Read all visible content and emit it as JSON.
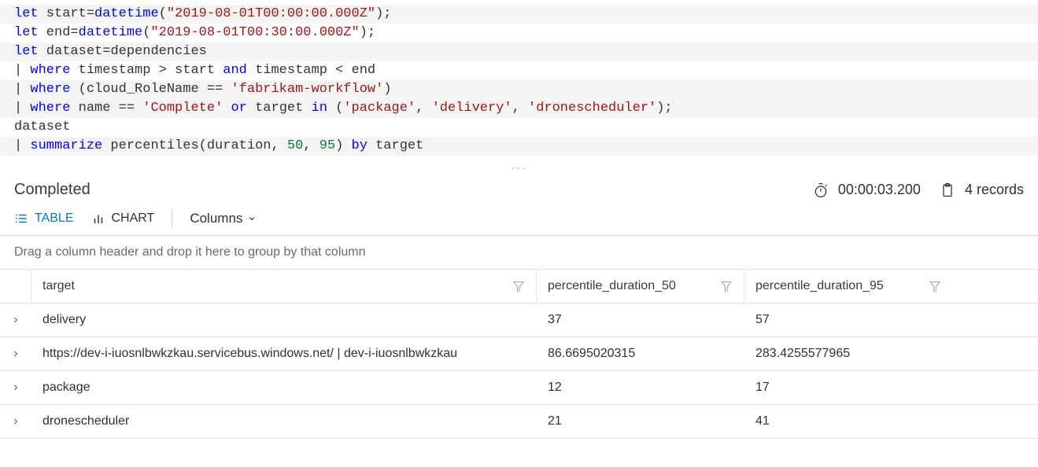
{
  "query": {
    "lines": [
      {
        "hl": true,
        "tokens": [
          [
            "kw",
            "let"
          ],
          [
            "id",
            " start"
          ],
          [
            "op",
            "="
          ],
          [
            "fn",
            "datetime"
          ],
          [
            "op",
            "("
          ],
          [
            "str",
            "\"2019-08-01T00:00:00.000Z\""
          ],
          [
            "op",
            ");"
          ]
        ]
      },
      {
        "hl": false,
        "tokens": [
          [
            "kw",
            "let"
          ],
          [
            "id",
            " end"
          ],
          [
            "op",
            "="
          ],
          [
            "fn",
            "datetime"
          ],
          [
            "op",
            "("
          ],
          [
            "str",
            "\"2019-08-01T00:30:00.000Z\""
          ],
          [
            "op",
            ");"
          ]
        ]
      },
      {
        "hl": true,
        "tokens": [
          [
            "kw",
            "let"
          ],
          [
            "id",
            " dataset"
          ],
          [
            "op",
            "="
          ],
          [
            "id",
            "dependencies"
          ]
        ]
      },
      {
        "hl": false,
        "tokens": [
          [
            "op",
            "| "
          ],
          [
            "kw",
            "where"
          ],
          [
            "id",
            " timestamp "
          ],
          [
            "op",
            ">"
          ],
          [
            "id",
            " start "
          ],
          [
            "kw",
            "and"
          ],
          [
            "id",
            " timestamp "
          ],
          [
            "op",
            "<"
          ],
          [
            "id",
            " end"
          ]
        ]
      },
      {
        "hl": true,
        "tokens": [
          [
            "op",
            "| "
          ],
          [
            "kw",
            "where"
          ],
          [
            "id",
            " (cloud_RoleName "
          ],
          [
            "op",
            "=="
          ],
          [
            "id",
            " "
          ],
          [
            "str",
            "'fabrikam-workflow'"
          ],
          [
            "op",
            ")"
          ]
        ]
      },
      {
        "hl": true,
        "tokens": [
          [
            "op",
            "| "
          ],
          [
            "kw",
            "where"
          ],
          [
            "id",
            " name "
          ],
          [
            "op",
            "=="
          ],
          [
            "id",
            " "
          ],
          [
            "str",
            "'Complete'"
          ],
          [
            "id",
            " "
          ],
          [
            "kw",
            "or"
          ],
          [
            "id",
            " target "
          ],
          [
            "kw",
            "in"
          ],
          [
            "id",
            " ("
          ],
          [
            "str",
            "'package'"
          ],
          [
            "op",
            ", "
          ],
          [
            "str",
            "'delivery'"
          ],
          [
            "op",
            ", "
          ],
          [
            "str",
            "'dronescheduler'"
          ],
          [
            "op",
            ");"
          ]
        ]
      },
      {
        "hl": false,
        "tokens": [
          [
            "id",
            "dataset"
          ]
        ]
      },
      {
        "hl": true,
        "tokens": [
          [
            "op",
            "| "
          ],
          [
            "kw",
            "summarize"
          ],
          [
            "id",
            " percentiles(duration, "
          ],
          [
            "num",
            "50"
          ],
          [
            "op",
            ", "
          ],
          [
            "num",
            "95"
          ],
          [
            "op",
            ") "
          ],
          [
            "kw",
            "by"
          ],
          [
            "id",
            " target"
          ]
        ]
      }
    ]
  },
  "status": {
    "text": "Completed",
    "duration": "00:00:03.200",
    "records": "4 records"
  },
  "viewTabs": {
    "table": "TABLE",
    "chart": "CHART",
    "columns": "Columns"
  },
  "groupBar": "Drag a column header and drop it here to group by that column",
  "columns": {
    "target": "target",
    "p50": "percentile_duration_50",
    "p95": "percentile_duration_95"
  },
  "rows": [
    {
      "target": "delivery",
      "p50": "37",
      "p95": "57"
    },
    {
      "target": "https://dev-i-iuosnlbwkzkau.servicebus.windows.net/ | dev-i-iuosnlbwkzkau",
      "p50": "86.6695020315",
      "p95": "283.4255577965"
    },
    {
      "target": "package",
      "p50": "12",
      "p95": "17"
    },
    {
      "target": "dronescheduler",
      "p50": "21",
      "p95": "41"
    }
  ]
}
